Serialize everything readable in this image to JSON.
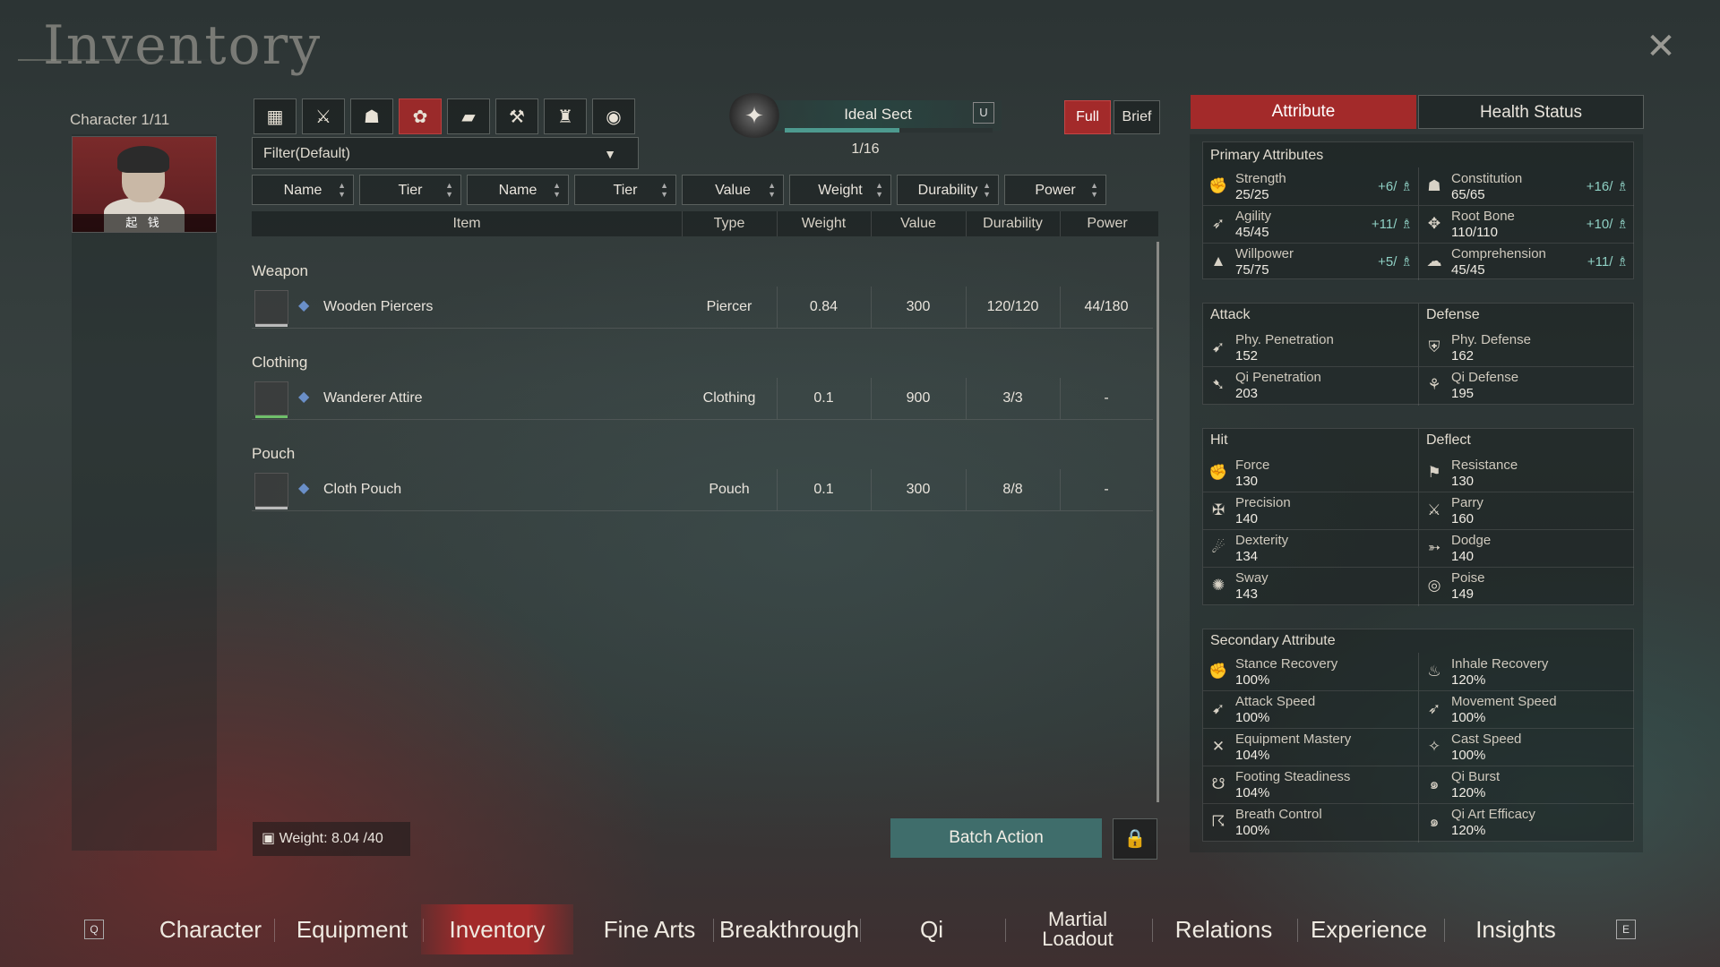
{
  "page": {
    "title": "Inventory"
  },
  "character": {
    "label": "Character 1/11",
    "name": "起 钱"
  },
  "categories": [
    {
      "icon": "grid-icon",
      "glyph": "▦",
      "active": false
    },
    {
      "icon": "weapon-category-icon",
      "glyph": "⚔",
      "active": false
    },
    {
      "icon": "armor-category-icon",
      "glyph": "☗",
      "active": false
    },
    {
      "icon": "consumable-category-icon",
      "glyph": "✿",
      "active": true
    },
    {
      "icon": "book-category-icon",
      "glyph": "▰",
      "active": false
    },
    {
      "icon": "material-category-icon",
      "glyph": "⚒",
      "active": false
    },
    {
      "icon": "pouch-category-icon",
      "glyph": "♜",
      "active": false
    },
    {
      "icon": "misc-category-icon",
      "glyph": "◉",
      "active": false
    }
  ],
  "filter": {
    "label": "Filter(Default)"
  },
  "sect": {
    "name": "Ideal Sect",
    "key": "U",
    "count": "1/16",
    "progress": 0.55
  },
  "view_toggle": {
    "full": "Full",
    "brief": "Brief"
  },
  "sort_buttons": [
    "Name",
    "Tier",
    "Name",
    "Tier",
    "Value",
    "Weight",
    "Durability",
    "Power"
  ],
  "table_headers": {
    "item": "Item",
    "type": "Type",
    "weight": "Weight",
    "value": "Value",
    "durability": "Durability",
    "power": "Power"
  },
  "sections": [
    {
      "title": "Weapon",
      "item": {
        "name": "Wooden Piercers",
        "type": "Piercer",
        "weight": "0.84",
        "value": "300",
        "durability": "120/120",
        "power": "44/180",
        "icon": "piercer-icon"
      }
    },
    {
      "title": "Clothing",
      "item": {
        "name": "Wanderer Attire",
        "type": "Clothing",
        "weight": "0.1",
        "value": "900",
        "durability": "3/3",
        "power": "-",
        "icon": "attire-icon"
      }
    },
    {
      "title": "Pouch",
      "item": {
        "name": "Cloth Pouch",
        "type": "Pouch",
        "weight": "0.1",
        "value": "300",
        "durability": "8/8",
        "power": "-",
        "icon": "pouch-icon"
      }
    }
  ],
  "weight": {
    "label": "Weight: 8.04 /40"
  },
  "batch_action": "Batch Action",
  "right_tabs": {
    "attribute": "Attribute",
    "health": "Health Status"
  },
  "primary": {
    "title": "Primary Attributes",
    "stats": [
      {
        "name": "Strength",
        "value": "25/25",
        "bonus": "+6/"
      },
      {
        "name": "Constitution",
        "value": "65/65",
        "bonus": "+16/"
      },
      {
        "name": "Agility",
        "value": "45/45",
        "bonus": "+11/"
      },
      {
        "name": "Root Bone",
        "value": "110/110",
        "bonus": "+10/"
      },
      {
        "name": "Willpower",
        "value": "75/75",
        "bonus": "+5/"
      },
      {
        "name": "Comprehension",
        "value": "45/45",
        "bonus": "+11/"
      }
    ]
  },
  "attack": {
    "title": "Attack",
    "stats": [
      {
        "name": "Phy. Penetration",
        "value": "152"
      },
      {
        "name": "Qi Penetration",
        "value": "203"
      }
    ]
  },
  "defense": {
    "title": "Defense",
    "stats": [
      {
        "name": "Phy. Defense",
        "value": "162"
      },
      {
        "name": "Qi Defense",
        "value": "195"
      }
    ]
  },
  "hit": {
    "title": "Hit",
    "stats": [
      {
        "name": "Force",
        "value": "130"
      },
      {
        "name": "Precision",
        "value": "140"
      },
      {
        "name": "Dexterity",
        "value": "134"
      },
      {
        "name": "Sway",
        "value": "143"
      }
    ]
  },
  "deflect": {
    "title": "Deflect",
    "stats": [
      {
        "name": "Resistance",
        "value": "130"
      },
      {
        "name": "Parry",
        "value": "160"
      },
      {
        "name": "Dodge",
        "value": "140"
      },
      {
        "name": "Poise",
        "value": "149"
      }
    ]
  },
  "secondary": {
    "title": "Secondary Attribute",
    "stats": [
      {
        "name": "Stance Recovery",
        "value": "100%"
      },
      {
        "name": "Inhale Recovery",
        "value": "120%"
      },
      {
        "name": "Attack Speed",
        "value": "100%"
      },
      {
        "name": "Movement Speed",
        "value": "100%"
      },
      {
        "name": "Equipment Mastery",
        "value": "104%"
      },
      {
        "name": "Cast Speed",
        "value": "100%"
      },
      {
        "name": "Footing Steadiness",
        "value": "104%"
      },
      {
        "name": "Qi Burst",
        "value": "120%"
      },
      {
        "name": "Breath Control",
        "value": "100%"
      },
      {
        "name": "Qi Art Efficacy",
        "value": "120%"
      }
    ]
  },
  "nav": {
    "key_left": "Q",
    "key_right": "E",
    "items": [
      "Character",
      "Equipment",
      "Inventory",
      "Fine Arts",
      "Breakthrough",
      "Qi",
      "Martial Loadout",
      "Relations",
      "Experience",
      "Insights"
    ],
    "martial_line1": "Martial",
    "martial_line2": "Loadout",
    "active": "Inventory"
  }
}
